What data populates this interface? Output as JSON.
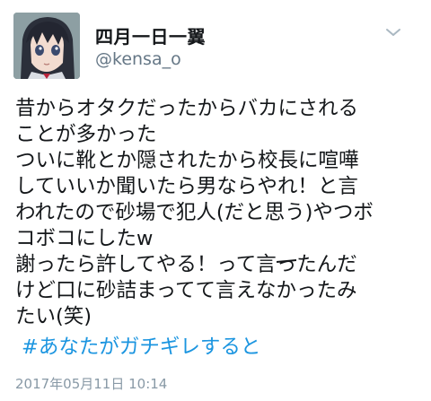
{
  "tweet": {
    "display_name": "四月一日一翼",
    "handle": "@kensa_o",
    "avatar_icon": "anime-character-avatar-icon",
    "menu_icon": "chevron-down-icon",
    "body_lines": [
      "昔からオタクだったからバカにされる",
      "ことが多かった",
      "ついに靴とか隠されたから校長に喧嘩",
      "していいか聞いたら男ならやれ！と言",
      "われたので砂場で犯人(だと思う)やつボ",
      "コボコにしたw"
    ],
    "line7_before": "謝ったら許してやる！って言",
    "line7_struck": "っ",
    "line7_after": "たんだ",
    "line8": "けど口に砂詰まってて言えなかったみ",
    "line9": "たい(笑)",
    "hashtag": "#あなたがガチギレすると",
    "timestamp": "2017年05月11日 10:14",
    "colors": {
      "text": "#14171a",
      "handle": "#657786",
      "link": "#1b95e0",
      "timestamp": "#8899a6"
    }
  }
}
